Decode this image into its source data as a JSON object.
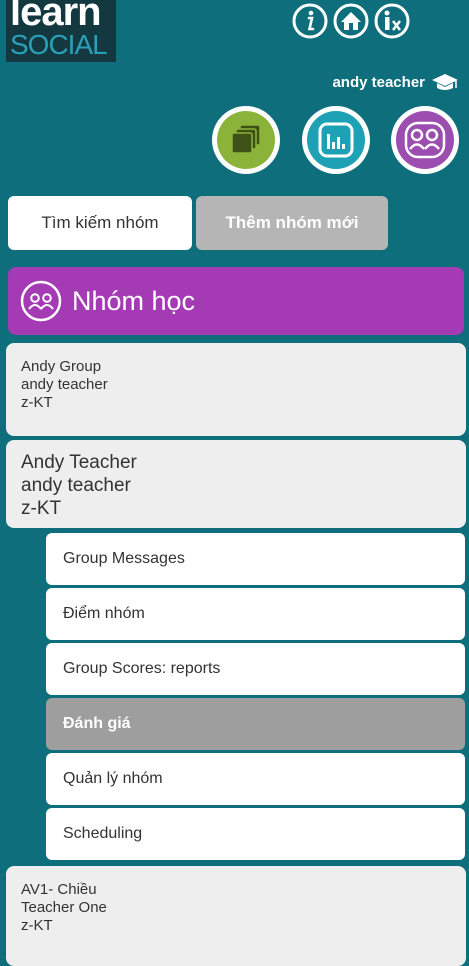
{
  "logo": {
    "line1": "learn",
    "line2": "SOCIAL"
  },
  "top_icons": [
    "info-icon",
    "home-icon",
    "info-x-icon"
  ],
  "user": {
    "name": "andy teacher",
    "icon": "graduation-cap-icon"
  },
  "nav_circles": [
    {
      "icon": "stack-icon",
      "color": "#8bb33a"
    },
    {
      "icon": "bar-chart-icon",
      "color": "#1fa1b5"
    },
    {
      "icon": "groups-icon",
      "color": "#9b4db0"
    }
  ],
  "actions": {
    "search_label": "Tìm kiếm nhóm",
    "add_label": "Thêm nhóm mới"
  },
  "header": {
    "title": "Nhóm học",
    "icon": "groups-icon"
  },
  "groups": [
    {
      "name": "Andy Group",
      "teacher": "andy teacher",
      "code": "z-KT"
    },
    {
      "name": "Andy Teacher",
      "teacher": "andy teacher",
      "code": "z-KT"
    },
    {
      "name": "AV1- Chiều",
      "teacher": "Teacher One",
      "code": "z-KT"
    }
  ],
  "submenu": [
    {
      "label": "Group Messages"
    },
    {
      "label": "Điểm nhóm"
    },
    {
      "label": "Group Scores: reports"
    },
    {
      "label": "Đánh giá",
      "active": true
    },
    {
      "label": "Quản lý nhóm"
    },
    {
      "label": "Scheduling"
    }
  ],
  "colors": {
    "background": "#0e6e7c",
    "header": "#a43ab4",
    "active_item": "#9e9e9e"
  }
}
